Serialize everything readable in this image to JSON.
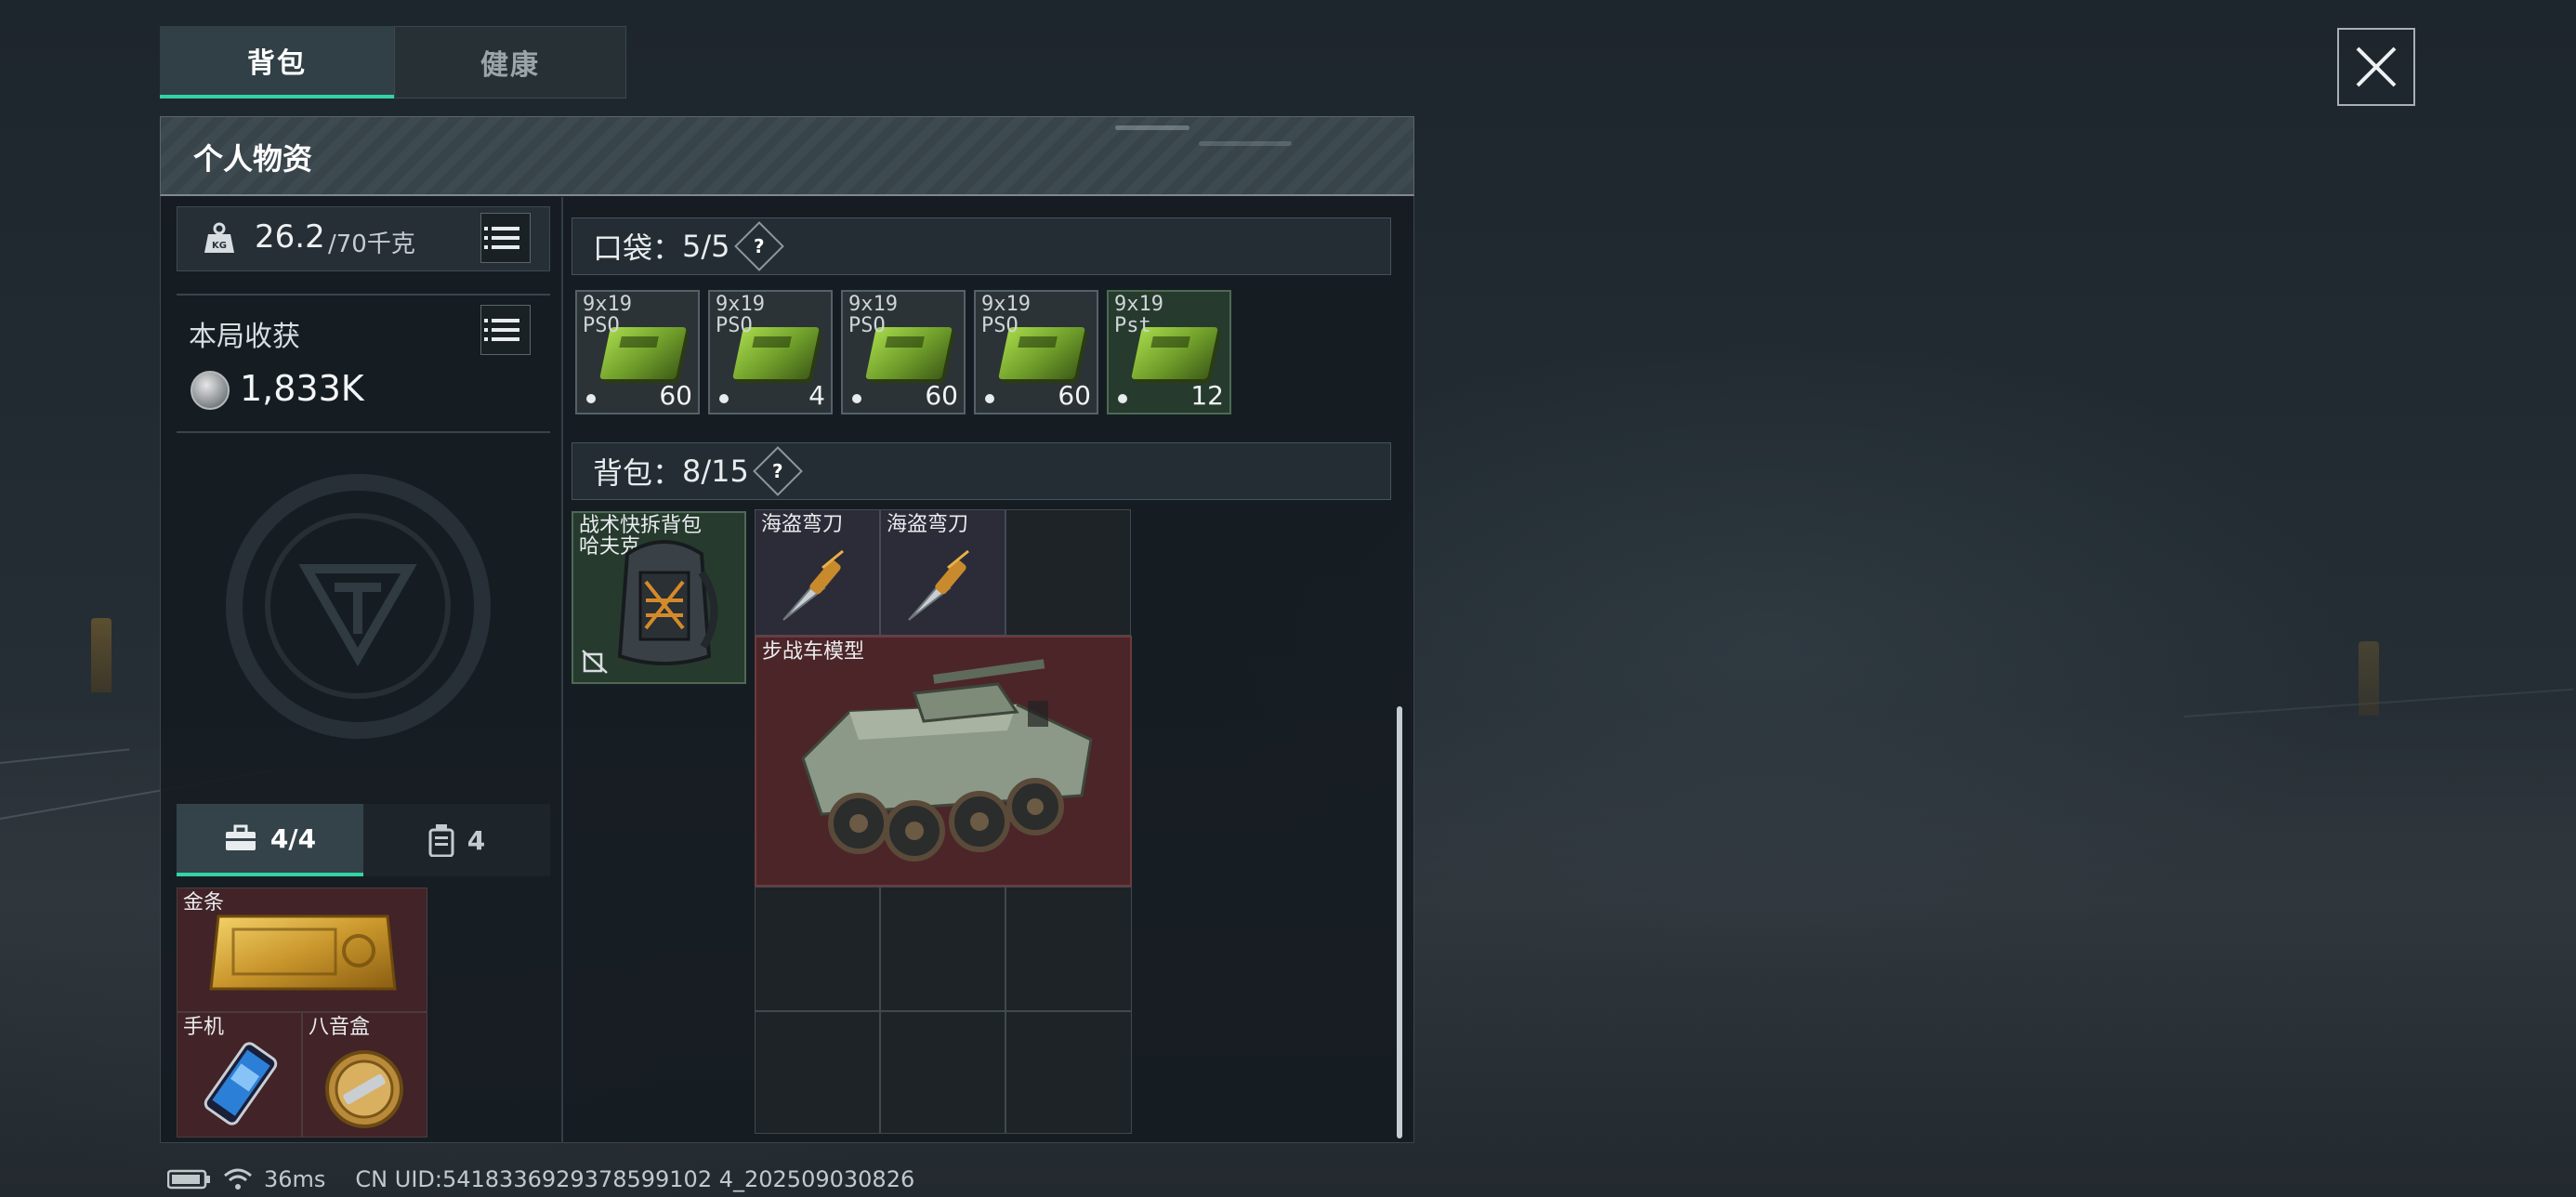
{
  "tabs": [
    {
      "label": "背包",
      "active": true
    },
    {
      "label": "健康",
      "active": false
    }
  ],
  "panel": {
    "title": "个人物资"
  },
  "weight": {
    "current": "26.2",
    "capacity": "/70千克",
    "icon": "kg-weight-icon"
  },
  "haul": {
    "label": "本局收获",
    "value": "1,833K",
    "icon": "coin-icon"
  },
  "container_tabs": [
    {
      "count": "4/4",
      "icon": "briefcase-icon",
      "active": true
    },
    {
      "count": "4",
      "icon": "canister-icon",
      "active": false
    }
  ],
  "secure_items": [
    {
      "name": "金条",
      "icon": "gold-bar-icon"
    },
    {
      "name": "手机",
      "icon": "phone-icon"
    },
    {
      "name": "八音盒",
      "icon": "music-box-icon"
    }
  ],
  "pockets": {
    "label": "口袋",
    "count": "5/5",
    "items": [
      {
        "name": "9x19\nPSO",
        "count": "60"
      },
      {
        "name": "9x19\nPSO",
        "count": "4"
      },
      {
        "name": "9x19\nPSO",
        "count": "60"
      },
      {
        "name": "9x19\nPSO",
        "count": "60"
      },
      {
        "name": "9x19\nPst",
        "count": "12"
      }
    ]
  },
  "backpack": {
    "label": "背包",
    "count": "8/15",
    "equipped": {
      "name": "战术快拆背包\n哈夫克",
      "icon": "backpack-icon"
    },
    "items": [
      {
        "name": "海盗弯刀",
        "icon": "knife-icon"
      },
      {
        "name": "海盗弯刀",
        "icon": "knife-icon"
      },
      {
        "name": "步战车模型",
        "icon": "ifv-model-icon"
      }
    ]
  },
  "status_bar": {
    "ping": "36ms",
    "uid": "CN UID:5418336929378599102 4_202509030826"
  },
  "colors": {
    "accent": "#34d3a6",
    "rare_red": "#4c2528",
    "epic_purple": "#2b2c37",
    "common_green": "#263b2e"
  }
}
